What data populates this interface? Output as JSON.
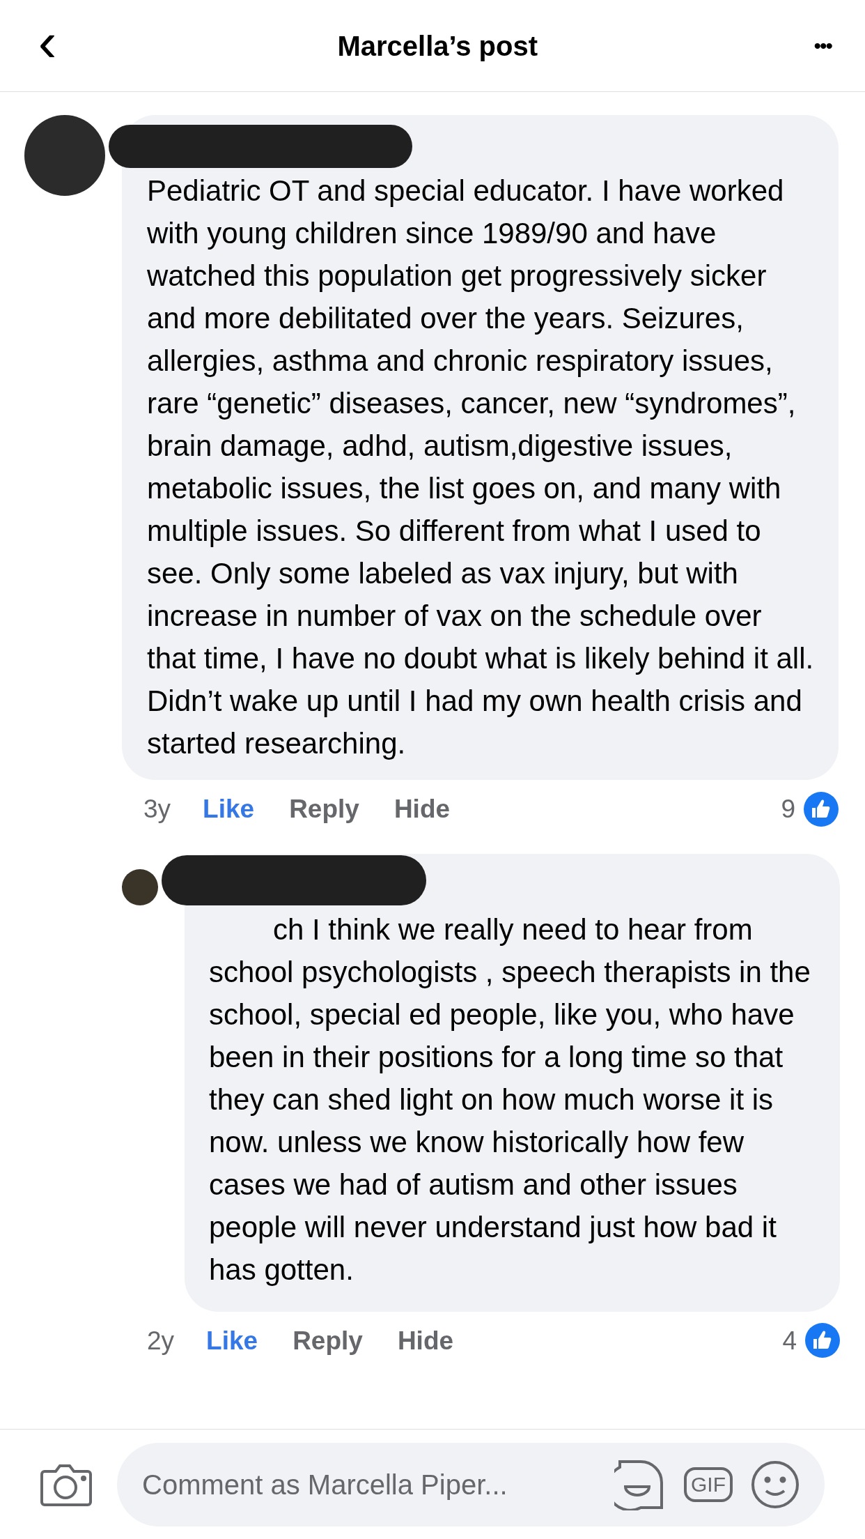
{
  "header": {
    "back": "‹",
    "title": "Marcella’s post",
    "more": "•••"
  },
  "comments": [
    {
      "text": "Pediatric OT and special educator. I have worked with young children since 1989/90 and have watched this population get progressively sicker and more debilitated over the years. Seizures, allergies, asthma and chronic respiratory issues, rare “genetic” diseases, cancer, new “syndromes”, brain damage, adhd, autism,digestive issues, metabolic issues, the list goes on, and many with multiple issues. So different from what I used to see. Only some labeled as vax injury, but with increase in number of vax on the schedule over that time, I have no doubt what is likely behind it all.  Didn’t wake up until I had my own health crisis and started researching.",
      "time": "3y",
      "actions": [
        "Like",
        "Reply",
        "Hide"
      ],
      "reactions": "9",
      "reply": false
    },
    {
      "text": "ch I think we really need to hear from school psychologists , speech therapists in the school, special ed people, like you, who have been in their positions for a long time so that they can shed light on how much worse it is now. unless we know historically how few cases we had of autism and other issues people will never understand just how bad it has gotten.",
      "time": "2y",
      "actions": [
        "Like",
        "Reply",
        "Hide"
      ],
      "reactions": "4",
      "reply": true
    }
  ],
  "composer": {
    "placeholder": "Comment as Marcella Piper...",
    "gif": "GIF"
  }
}
